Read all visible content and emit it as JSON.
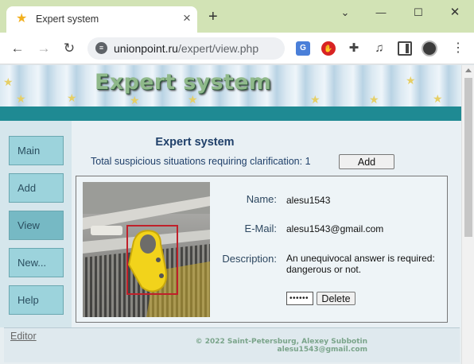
{
  "browser": {
    "tab_title": "Expert system",
    "url_host": "unionpoint.ru",
    "url_path": "/expert/view.php",
    "window_controls": {
      "chevron": "⌄",
      "minimize": "—",
      "maximize": "☐",
      "close": "✕"
    }
  },
  "banner": {
    "title": "Expert system"
  },
  "sidebar": {
    "items": [
      {
        "label": "Main"
      },
      {
        "label": "Add"
      },
      {
        "label": "View",
        "active": true
      },
      {
        "label": "New..."
      },
      {
        "label": "Help"
      }
    ]
  },
  "main": {
    "title": "Expert system",
    "total_label": "Total suspicious situations requiring clarification:",
    "total_count": "1",
    "add_button": "Add"
  },
  "record": {
    "name_label": "Name:",
    "name_value": "alesu1543",
    "email_label": "E-Mail:",
    "email_value": "alesu1543@gmail.com",
    "description_label": "Description:",
    "description_value": "An unequivocal answer is required: dangerous or not.",
    "password_mask": "••••••",
    "delete_button": "Delete"
  },
  "footer": {
    "editor_link": "Editor",
    "copyright_line1": "© 2022 Saint-Petersburg, Alexey Subbotin",
    "copyright_line2": "alesu1543@gmail.com"
  },
  "icons": {
    "tab_favicon": "star-icon",
    "site_info": "tune-icon",
    "translate": "google-translate-icon",
    "adblock": "adblock-icon",
    "extensions": "puzzle-icon",
    "media": "media-control-icon",
    "side_panel": "side-panel-icon",
    "menu": "kebab-menu-icon"
  },
  "colors": {
    "teal_bar": "#1f8a93",
    "nav_button": "#9cd3dc",
    "heading": "#20406a"
  }
}
